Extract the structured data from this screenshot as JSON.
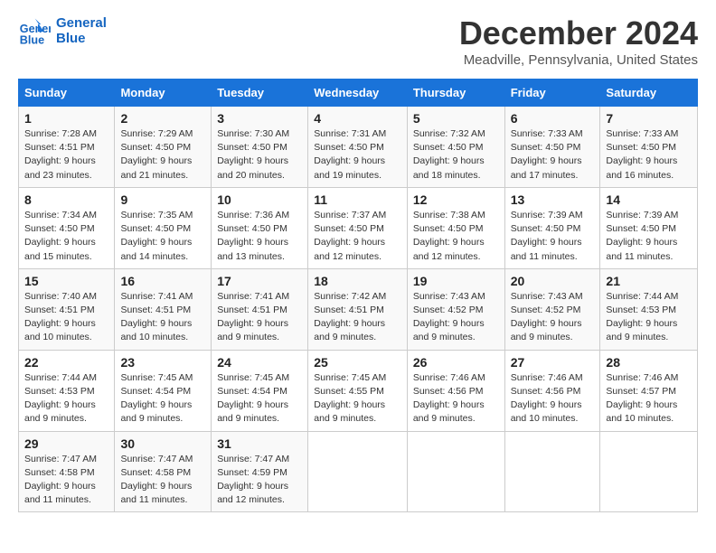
{
  "logo": {
    "line1": "General",
    "line2": "Blue"
  },
  "title": "December 2024",
  "location": "Meadville, Pennsylvania, United States",
  "days_of_week": [
    "Sunday",
    "Monday",
    "Tuesday",
    "Wednesday",
    "Thursday",
    "Friday",
    "Saturday"
  ],
  "weeks": [
    [
      {
        "day": "1",
        "sunrise": "7:28 AM",
        "sunset": "4:51 PM",
        "daylight": "9 hours and 23 minutes."
      },
      {
        "day": "2",
        "sunrise": "7:29 AM",
        "sunset": "4:50 PM",
        "daylight": "9 hours and 21 minutes."
      },
      {
        "day": "3",
        "sunrise": "7:30 AM",
        "sunset": "4:50 PM",
        "daylight": "9 hours and 20 minutes."
      },
      {
        "day": "4",
        "sunrise": "7:31 AM",
        "sunset": "4:50 PM",
        "daylight": "9 hours and 19 minutes."
      },
      {
        "day": "5",
        "sunrise": "7:32 AM",
        "sunset": "4:50 PM",
        "daylight": "9 hours and 18 minutes."
      },
      {
        "day": "6",
        "sunrise": "7:33 AM",
        "sunset": "4:50 PM",
        "daylight": "9 hours and 17 minutes."
      },
      {
        "day": "7",
        "sunrise": "7:33 AM",
        "sunset": "4:50 PM",
        "daylight": "9 hours and 16 minutes."
      }
    ],
    [
      {
        "day": "8",
        "sunrise": "7:34 AM",
        "sunset": "4:50 PM",
        "daylight": "9 hours and 15 minutes."
      },
      {
        "day": "9",
        "sunrise": "7:35 AM",
        "sunset": "4:50 PM",
        "daylight": "9 hours and 14 minutes."
      },
      {
        "day": "10",
        "sunrise": "7:36 AM",
        "sunset": "4:50 PM",
        "daylight": "9 hours and 13 minutes."
      },
      {
        "day": "11",
        "sunrise": "7:37 AM",
        "sunset": "4:50 PM",
        "daylight": "9 hours and 12 minutes."
      },
      {
        "day": "12",
        "sunrise": "7:38 AM",
        "sunset": "4:50 PM",
        "daylight": "9 hours and 12 minutes."
      },
      {
        "day": "13",
        "sunrise": "7:39 AM",
        "sunset": "4:50 PM",
        "daylight": "9 hours and 11 minutes."
      },
      {
        "day": "14",
        "sunrise": "7:39 AM",
        "sunset": "4:50 PM",
        "daylight": "9 hours and 11 minutes."
      }
    ],
    [
      {
        "day": "15",
        "sunrise": "7:40 AM",
        "sunset": "4:51 PM",
        "daylight": "9 hours and 10 minutes."
      },
      {
        "day": "16",
        "sunrise": "7:41 AM",
        "sunset": "4:51 PM",
        "daylight": "9 hours and 10 minutes."
      },
      {
        "day": "17",
        "sunrise": "7:41 AM",
        "sunset": "4:51 PM",
        "daylight": "9 hours and 9 minutes."
      },
      {
        "day": "18",
        "sunrise": "7:42 AM",
        "sunset": "4:51 PM",
        "daylight": "9 hours and 9 minutes."
      },
      {
        "day": "19",
        "sunrise": "7:43 AM",
        "sunset": "4:52 PM",
        "daylight": "9 hours and 9 minutes."
      },
      {
        "day": "20",
        "sunrise": "7:43 AM",
        "sunset": "4:52 PM",
        "daylight": "9 hours and 9 minutes."
      },
      {
        "day": "21",
        "sunrise": "7:44 AM",
        "sunset": "4:53 PM",
        "daylight": "9 hours and 9 minutes."
      }
    ],
    [
      {
        "day": "22",
        "sunrise": "7:44 AM",
        "sunset": "4:53 PM",
        "daylight": "9 hours and 9 minutes."
      },
      {
        "day": "23",
        "sunrise": "7:45 AM",
        "sunset": "4:54 PM",
        "daylight": "9 hours and 9 minutes."
      },
      {
        "day": "24",
        "sunrise": "7:45 AM",
        "sunset": "4:54 PM",
        "daylight": "9 hours and 9 minutes."
      },
      {
        "day": "25",
        "sunrise": "7:45 AM",
        "sunset": "4:55 PM",
        "daylight": "9 hours and 9 minutes."
      },
      {
        "day": "26",
        "sunrise": "7:46 AM",
        "sunset": "4:56 PM",
        "daylight": "9 hours and 9 minutes."
      },
      {
        "day": "27",
        "sunrise": "7:46 AM",
        "sunset": "4:56 PM",
        "daylight": "9 hours and 10 minutes."
      },
      {
        "day": "28",
        "sunrise": "7:46 AM",
        "sunset": "4:57 PM",
        "daylight": "9 hours and 10 minutes."
      }
    ],
    [
      {
        "day": "29",
        "sunrise": "7:47 AM",
        "sunset": "4:58 PM",
        "daylight": "9 hours and 11 minutes."
      },
      {
        "day": "30",
        "sunrise": "7:47 AM",
        "sunset": "4:58 PM",
        "daylight": "9 hours and 11 minutes."
      },
      {
        "day": "31",
        "sunrise": "7:47 AM",
        "sunset": "4:59 PM",
        "daylight": "9 hours and 12 minutes."
      },
      null,
      null,
      null,
      null
    ]
  ],
  "labels": {
    "sunrise": "Sunrise:",
    "sunset": "Sunset:",
    "daylight": "Daylight:"
  }
}
